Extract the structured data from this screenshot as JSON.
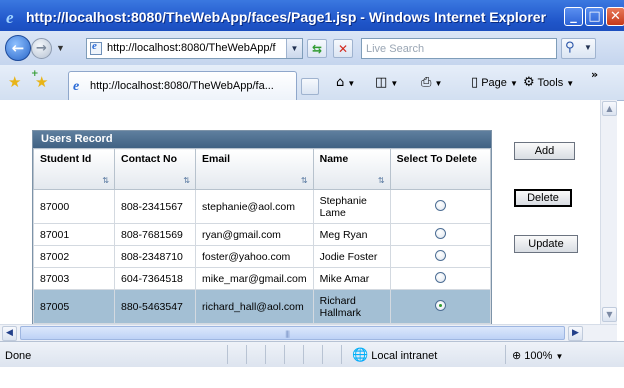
{
  "window": {
    "title": "http://localhost:8080/TheWebApp/faces/Page1.jsp - Windows Internet Explorer"
  },
  "nav": {
    "address": "http://localhost:8080/TheWebApp/f",
    "search_placeholder": "Live Search"
  },
  "tab": {
    "title": "http://localhost:8080/TheWebApp/fa..."
  },
  "toolbar": {
    "page_label": "Page",
    "tools_label": "Tools"
  },
  "panel": {
    "title": "Users Record",
    "columns": [
      "Student Id",
      "Contact No",
      "Email",
      "Name",
      "Select To Delete"
    ],
    "rows": [
      {
        "id": "87000",
        "contact": "808-2341567",
        "email": "stephanie@aol.com",
        "name": "Stephanie Lame",
        "selected": false
      },
      {
        "id": "87001",
        "contact": "808-7681569",
        "email": "ryan@gmail.com",
        "name": "Meg Ryan",
        "selected": false
      },
      {
        "id": "87002",
        "contact": "808-2348710",
        "email": "foster@yahoo.com",
        "name": "Jodie Foster",
        "selected": false
      },
      {
        "id": "87003",
        "contact": "604-7364518",
        "email": "mike_mar@gmail.com",
        "name": "Mike Amar",
        "selected": false
      },
      {
        "id": "87005",
        "contact": "880-5463547",
        "email": "richard_hall@aol.com",
        "name": "Richard Hallmark",
        "selected": true
      }
    ]
  },
  "buttons": {
    "add": "Add",
    "delete": "Delete",
    "update": "Update"
  },
  "status": {
    "text": "Done",
    "zone": "Local intranet",
    "zoom": "100%"
  },
  "colors": {
    "title_bar": "#1f55c9",
    "panel_header": "#4a6a8c",
    "selected_row": "#a3bfd4"
  }
}
